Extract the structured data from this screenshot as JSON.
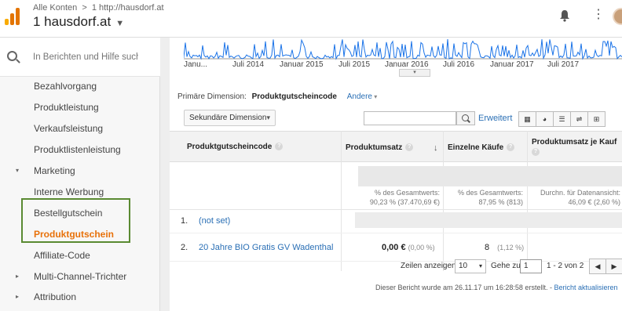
{
  "header": {
    "breadcrumb_root": "Alle Konten",
    "breadcrumb_sep": ">",
    "breadcrumb_property": "1 http://hausdorf.at",
    "account_title": "1 hausdorf.at",
    "logo_colors": [
      "#f9ab00",
      "#e37400",
      "#e37400"
    ]
  },
  "sidebar": {
    "search_placeholder": "In Berichten und Hilfe such",
    "items": [
      {
        "label": "Bezahlvorgang",
        "arrow": ""
      },
      {
        "label": "Produktleistung",
        "arrow": ""
      },
      {
        "label": "Verkaufsleistung",
        "arrow": ""
      },
      {
        "label": "Produktlistenleistung",
        "arrow": ""
      },
      {
        "label": "Marketing",
        "arrow": "▾"
      },
      {
        "label": "Interne Werbung",
        "arrow": ""
      },
      {
        "label": "Bestellgutschein",
        "arrow": ""
      },
      {
        "label": "Produktgutschein",
        "arrow": ""
      },
      {
        "label": "Affiliate-Code",
        "arrow": ""
      },
      {
        "label": "Multi-Channel-Trichter",
        "arrow": "▸"
      },
      {
        "label": "Attribution",
        "arrow": "▸"
      }
    ],
    "active_color": "#e8710a",
    "highlight_color": "#5a8a32"
  },
  "timeline": {
    "labels": [
      "Janu...",
      "Juli 2014",
      "Januar 2015",
      "Juli 2015",
      "Januar 2016",
      "Juli 2016",
      "Januar 2017",
      "Juli 2017"
    ],
    "line_color": "#1a73e8"
  },
  "dimension": {
    "primary_label": "Primäre Dimension:",
    "current": "Produktgutscheincode",
    "other": "Andere"
  },
  "toolbar": {
    "secondary_dimension": "Sekundäre Dimension",
    "search_value": "",
    "advanced": "Erweitert"
  },
  "table": {
    "headers": [
      "Produktgutscheincode",
      "Produktumsatz",
      "Einzelne Käufe",
      "Produktumsatz je Kauf"
    ],
    "totals": {
      "revenue": [
        "% des Gesamtwerts:",
        "90,23 % (37.470,69 €)"
      ],
      "purchases": [
        "% des Gesamtwerts:",
        "87,95 % (813)"
      ],
      "per_purchase": [
        "Durchn. für Datenansicht:",
        "46,09 € (2,60 %)"
      ]
    },
    "rows": [
      {
        "num": "1.",
        "name": "(not set)",
        "revenue": "",
        "revenue_pct": "",
        "purchases": "",
        "purchases_pct": ""
      },
      {
        "num": "2.",
        "name": "20 Jahre BIO Gratis GV Wadenthal",
        "revenue": "0,00 €",
        "revenue_pct": "(0,00 %)",
        "purchases": "8",
        "purchases_pct": "(1,12 %)"
      }
    ]
  },
  "pager": {
    "rows_label": "Zeilen anzeigen:",
    "rows_value": "10",
    "goto_label": "Gehe zu:",
    "goto_value": "1",
    "range": "1 - 2 von 2"
  },
  "footer": {
    "text": "Dieser Bericht wurde am 26.11.17 um 16:28:58 erstellt. - ",
    "link": "Bericht aktualisieren"
  }
}
